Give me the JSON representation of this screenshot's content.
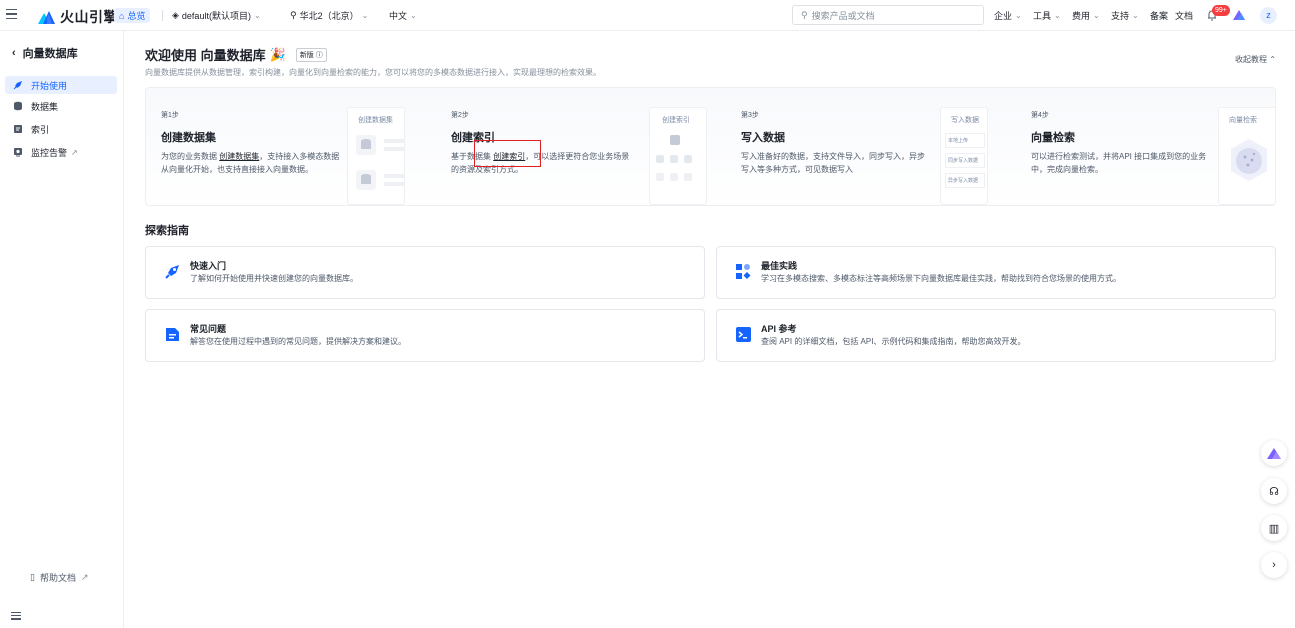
{
  "topbar": {
    "brand": "火山引擎",
    "home": "总览",
    "project": "default(默认项目)",
    "region": "华北2（北京）",
    "language": "中文",
    "search_placeholder": "搜索产品或文档",
    "nav": [
      "企业",
      "工具",
      "费用",
      "支持",
      "备案",
      "文档"
    ],
    "badge": "99+",
    "avatar": "z"
  },
  "sidebar": {
    "title": "向量数据库",
    "items": [
      {
        "label": "开始使用",
        "icon": "rocket-icon",
        "active": true
      },
      {
        "label": "数据集",
        "icon": "database-icon",
        "active": false
      },
      {
        "label": "索引",
        "icon": "index-icon",
        "active": false
      },
      {
        "label": "监控告警",
        "icon": "monitor-icon",
        "active": false
      }
    ],
    "help": "帮助文档"
  },
  "header": {
    "title": "欢迎使用 向量数据库",
    "tag": "新版",
    "description": "向量数据库提供从数据管理，索引构建，向量化到向量检索的能力，您可以将您的多模态数据进行接入，实现最理想的检索效果。",
    "collapse": "收起教程"
  },
  "steps": [
    {
      "no": "第1步",
      "title": "创建数据集",
      "desc_pre": "为您的业务数据 ",
      "desc_link": "创建数据集",
      "desc_post": "，支持接入多模态数据从向量化开始，也支持直接接入向量数据。",
      "img_label": "创建数据集"
    },
    {
      "no": "第2步",
      "title": "创建索引",
      "desc_pre": "基于数据集 ",
      "desc_link": "创建索引",
      "desc_post": "，可以选择更符合您业务场景的资源及索引方式。",
      "img_label": "创建索引"
    },
    {
      "no": "第3步",
      "title": "写入数据",
      "desc_pre": "写入准备好的数据，支持文件导入，同步写入，异步写入等多种方式，可见数据写入",
      "desc_link": "",
      "desc_post": "",
      "img_label": "写入数据",
      "img_rows": [
        "本地上传",
        "同步写入数据",
        "异步写入数据"
      ]
    },
    {
      "no": "第4步",
      "title": "向量检索",
      "desc_pre": "可以进行检索测试，并将API 接口集成到您的业务中，完成向量检索。",
      "desc_link": "",
      "desc_post": "",
      "img_label": "向量检索"
    }
  ],
  "guide": {
    "title": "探索指南",
    "cards": [
      {
        "title": "快速入门",
        "desc": "了解如何开始使用并快速创建您的向量数据库。",
        "icon": "rocket-icon"
      },
      {
        "title": "最佳实践",
        "desc": "学习在多模态搜索、多模态标注等高频场景下向量数据库最佳实践，帮助找到符合您场景的使用方式。",
        "icon": "shapes-icon"
      },
      {
        "title": "常见问题",
        "desc": "解答您在使用过程中遇到的常见问题，提供解决方案和建议。",
        "icon": "document-icon"
      },
      {
        "title": "API 参考",
        "desc": "查阅 API 的详细文档，包括 API、示例代码和集成指南，帮助您高效开发。",
        "icon": "terminal-icon"
      }
    ]
  },
  "colors": {
    "accent": "#1664ff",
    "highlight": "#e02020"
  }
}
